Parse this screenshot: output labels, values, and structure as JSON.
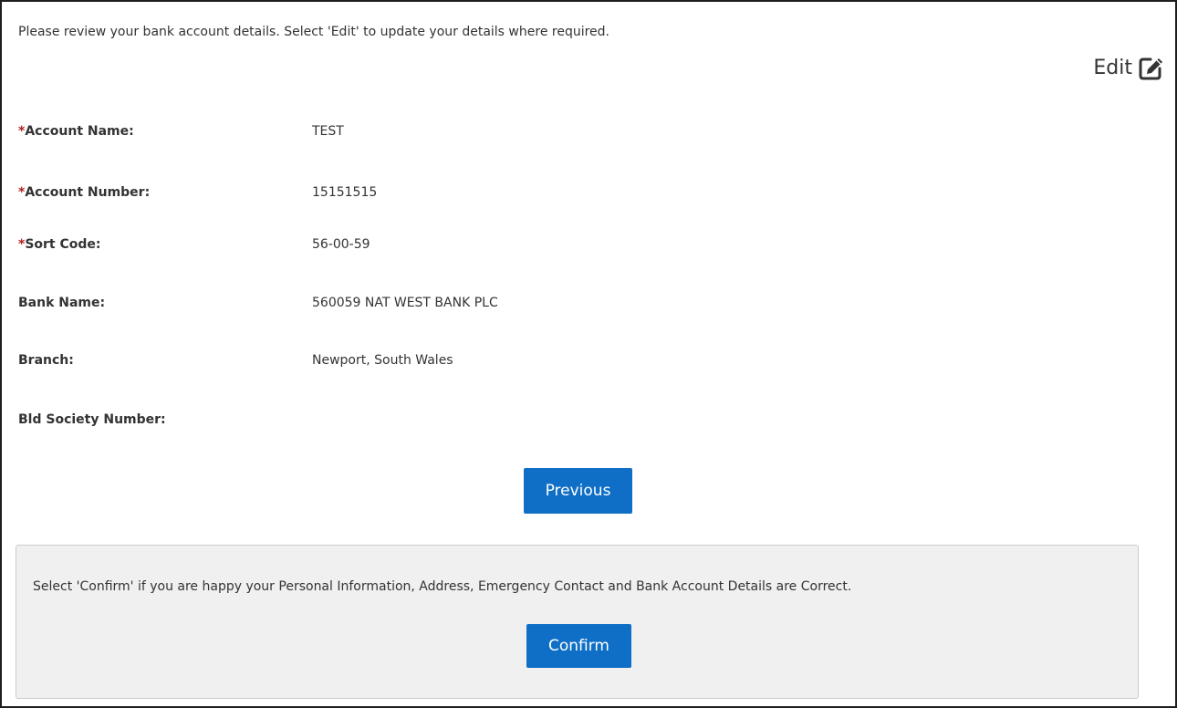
{
  "intro": {
    "text": "Please review your bank account details. Select 'Edit' to update your details where required."
  },
  "edit": {
    "label": "Edit",
    "icon": "edit-icon"
  },
  "required_marker": "*",
  "fields": [
    {
      "label": "Account Name:",
      "value": "TEST",
      "required": true
    },
    {
      "label": "Account Number:",
      "value": "15151515",
      "required": true
    },
    {
      "label": "Sort Code:",
      "value": "56-00-59",
      "required": true
    },
    {
      "label": "Bank Name:",
      "value": "560059 NAT WEST BANK PLC",
      "required": false
    },
    {
      "label": "Branch:",
      "value": "Newport, South Wales",
      "required": false
    },
    {
      "label": "Bld Society Number:",
      "value": "",
      "required": false
    }
  ],
  "buttons": {
    "previous": "Previous",
    "confirm": "Confirm"
  },
  "confirm_panel": {
    "message": "Select 'Confirm' if you are happy your Personal Information, Address, Emergency Contact and Bank Account Details are Correct."
  },
  "colors": {
    "button_bg": "#0f6fc6",
    "required": "#b22222",
    "panel_bg": "#f0f0f0"
  }
}
